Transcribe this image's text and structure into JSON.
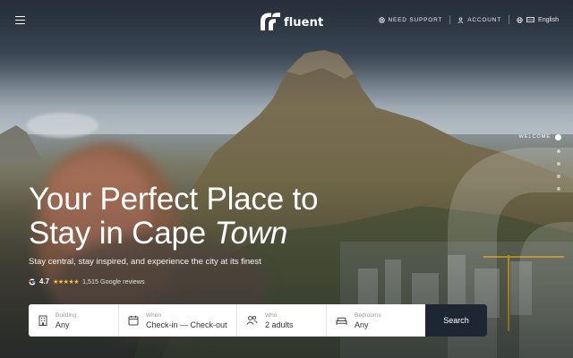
{
  "brand": {
    "name": "fluent"
  },
  "nav": {
    "menu_icon": "hamburger-icon",
    "support_label": "NEED SUPPORT",
    "account_label": "ACCOUNT",
    "language_label": "English"
  },
  "pager": {
    "active_label": "WELCOME",
    "dot_count": 5
  },
  "hero": {
    "title_line1": "Your Perfect Place to",
    "title_line2_plain": "Stay in Cape ",
    "title_line2_italic": "Town",
    "tagline": "Stay central, stay inspired, and experience the city at its finest",
    "rating_score": "4.7",
    "rating_stars": "★★★★★",
    "rating_reviews": "1,515 Google reviews"
  },
  "booking": {
    "building": {
      "label": "Building",
      "value": "Any",
      "icon": "building-icon"
    },
    "when": {
      "label": "When",
      "value": "Check-in — Check-out",
      "icon": "calendar-icon"
    },
    "who": {
      "label": "Who",
      "value": "2 adults",
      "icon": "people-icon"
    },
    "bedrooms": {
      "label": "Bedrooms",
      "value": "Any",
      "icon": "bed-icon"
    },
    "search_label": "Search"
  },
  "colors": {
    "search_button": "#1d2733",
    "star": "#f5c542",
    "booking_bg": "#ffffff"
  }
}
